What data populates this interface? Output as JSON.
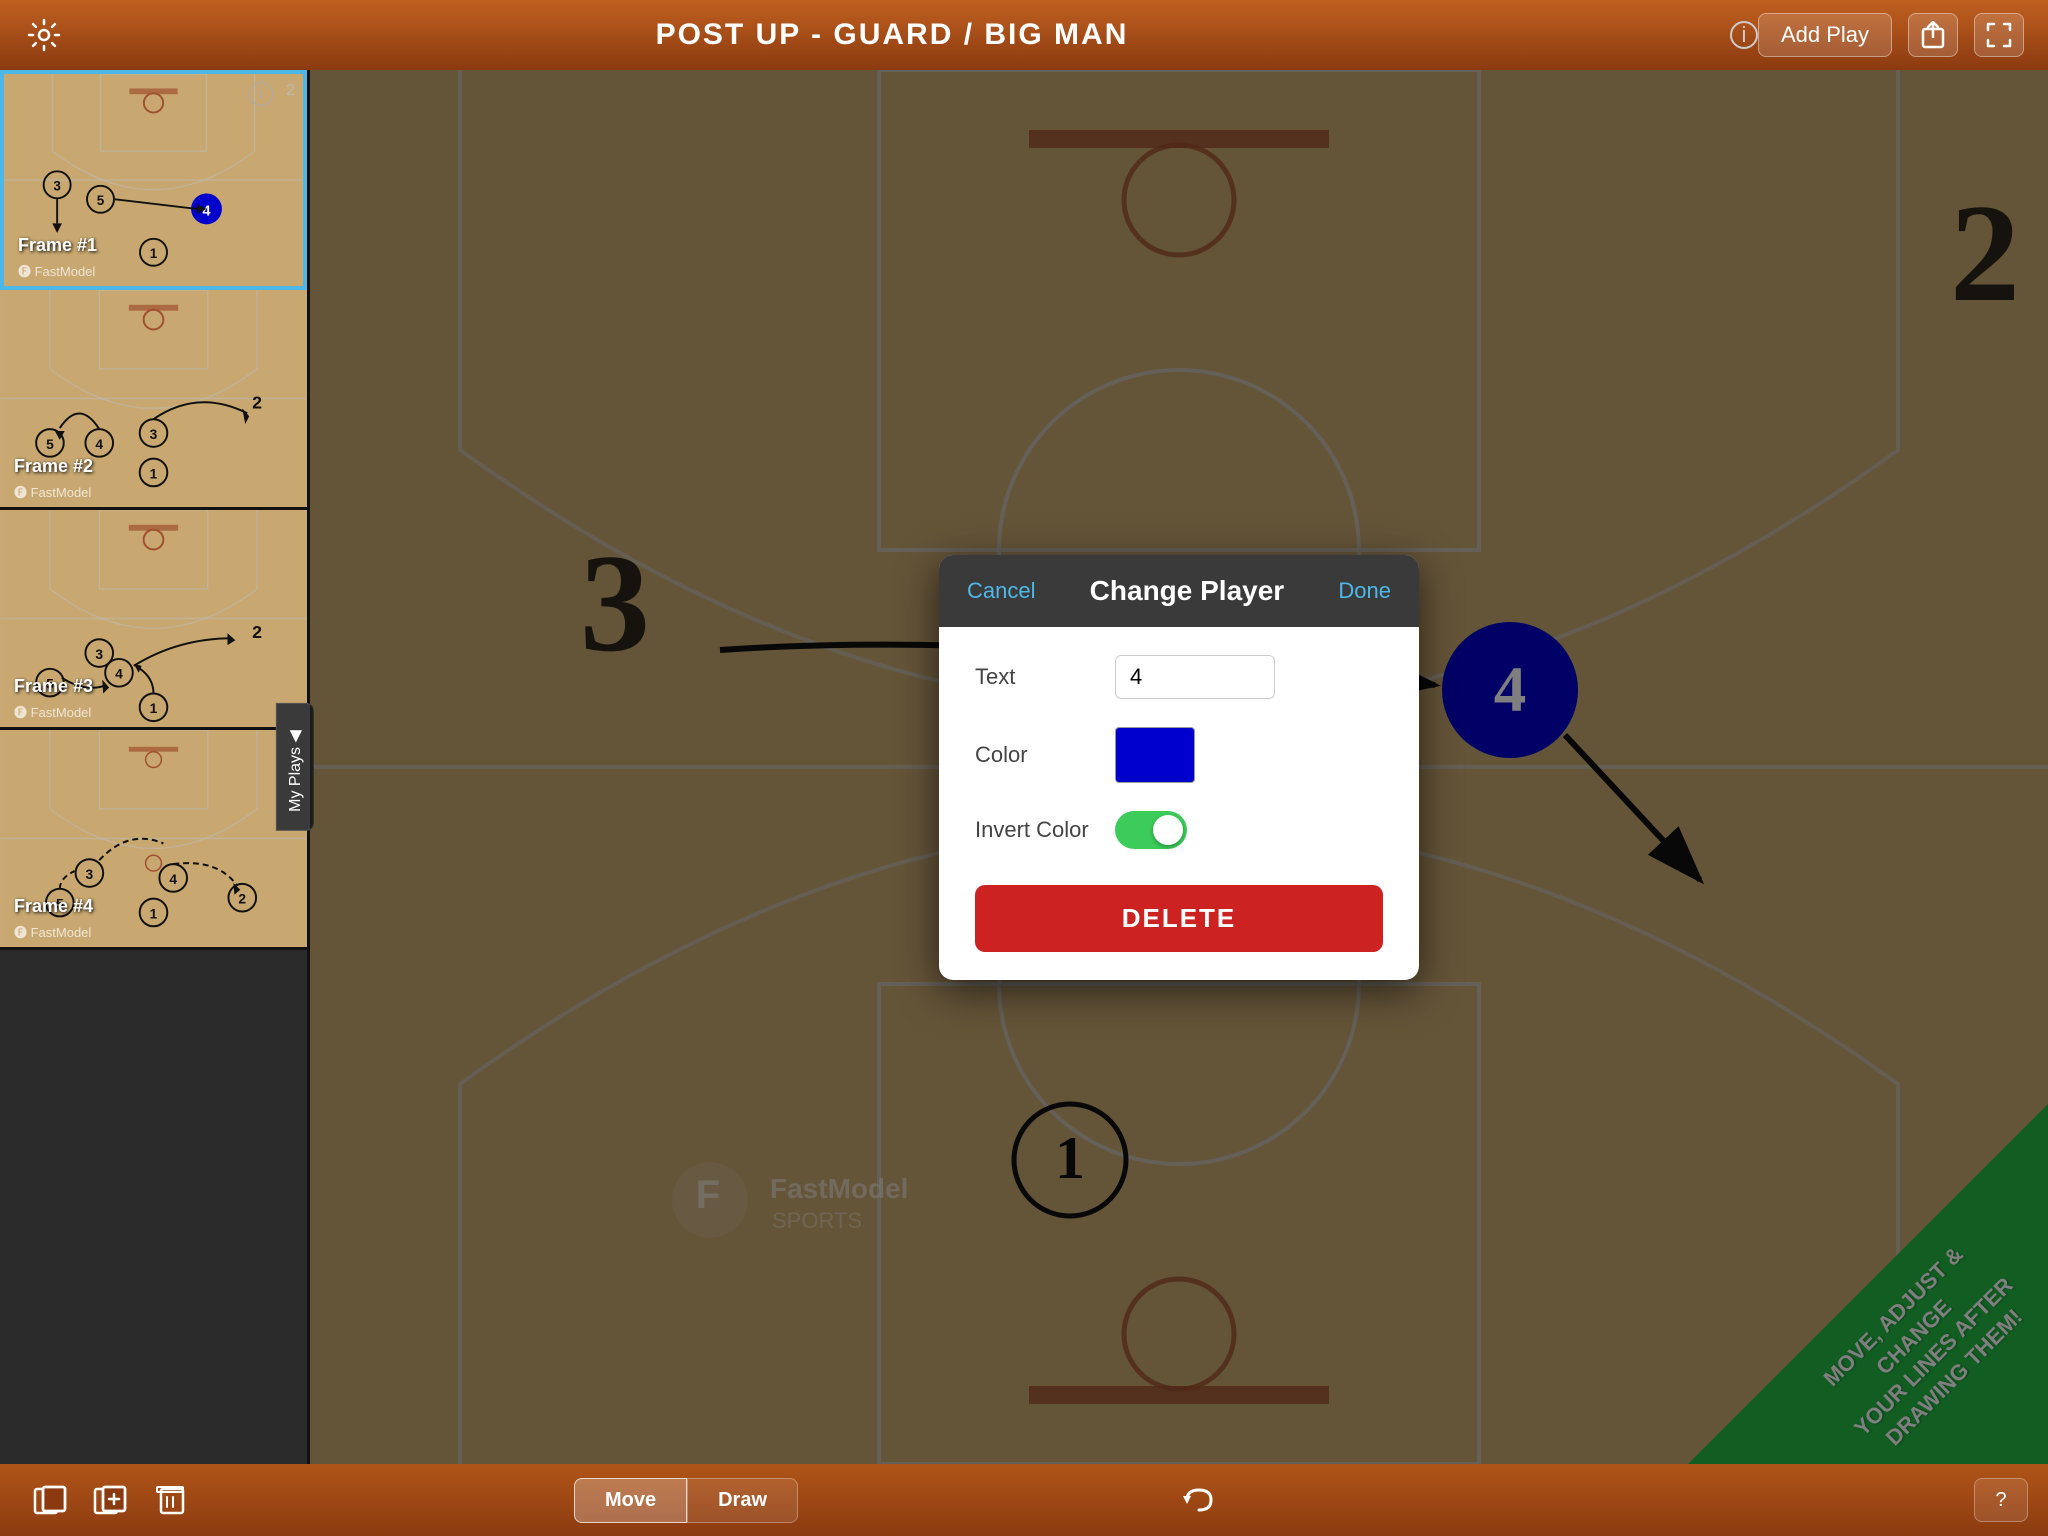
{
  "topBar": {
    "title": "POST UP - GUARD / BIG MAN",
    "addPlayLabel": "Add Play",
    "infoIcon": "ⓘ",
    "gearIcon": "⚙"
  },
  "sidebar": {
    "frames": [
      {
        "label": "Frame #1",
        "number": "2",
        "active": true
      },
      {
        "label": "Frame #2",
        "number": "",
        "active": false
      },
      {
        "label": "Frame #3",
        "number": "",
        "active": false
      },
      {
        "label": "Frame #4",
        "number": "",
        "active": false
      }
    ],
    "myPlaysTab": "My Plays"
  },
  "court": {
    "numberRight": "2",
    "player4Number": "4",
    "player1Number": "1"
  },
  "modal": {
    "title": "Change Player",
    "cancelLabel": "Cancel",
    "doneLabel": "Done",
    "textLabel": "Text",
    "textValue": "4",
    "colorLabel": "Color",
    "colorValue": "#0000cc",
    "invertColorLabel": "Invert Color",
    "invertColorOn": true,
    "deleteLabel": "DELETE"
  },
  "promo": {
    "line1": "MOVE, ADJUST & CHANGE",
    "line2": "YOUR LINES AFTER",
    "line3": "DRAWING THEM!"
  },
  "bottomBar": {
    "moveLabel": "Move",
    "drawLabel": "Draw",
    "helpIcon": "?",
    "undoIcon": "↩"
  }
}
